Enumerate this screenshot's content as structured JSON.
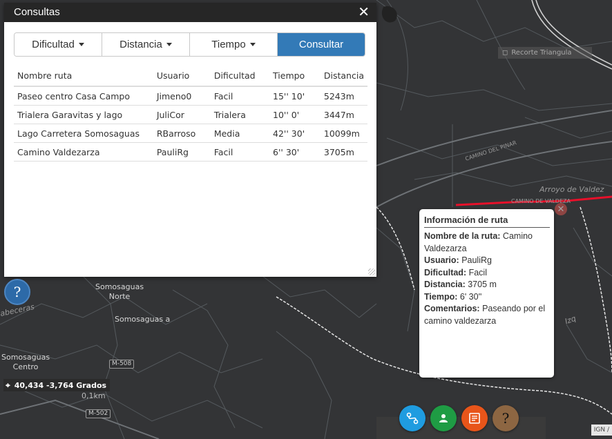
{
  "dialog": {
    "title": "Consultas",
    "close_glyph": "✕",
    "filters": [
      "Dificultad",
      "Distancia",
      "Tiempo"
    ],
    "consult_label": "Consultar",
    "table": {
      "headers": [
        "Nombre ruta",
        "Usuario",
        "Dificultad",
        "Tiempo",
        "Distancia"
      ],
      "rows": [
        [
          "Paseo centro Casa Campo",
          "Jimeno0",
          "Facil",
          "15'' 10'",
          "5243m"
        ],
        [
          "Trialera Garavitas y lago",
          "JuliCor",
          "Trialera",
          "10'' 0'",
          "3447m"
        ],
        [
          "Lago Carretera Somosaguas",
          "RBarroso",
          "Media",
          "42'' 30'",
          "10099m"
        ],
        [
          "Camino Valdezarza",
          "PauliRg",
          "Facil",
          "6'' 30'",
          "3705m"
        ]
      ]
    }
  },
  "help_left_glyph": "?",
  "coords": {
    "text": "40,434 -3,764 Grados",
    "icon": "crosshair-icon"
  },
  "map_labels": {
    "somosaguas_norte_1": "Somosaguas",
    "somosaguas_norte_2": "Norte",
    "somosaguas_a": "Somosaguas a",
    "somosaguas_centro_1": "Somosaguas",
    "somosaguas_centro_2": "Centro",
    "abecera": "abeceras",
    "arroyo": "Arroyo de Valdez",
    "camino_pinar": "CAMINO DEL PINAR",
    "camino_valdez": "CAMINO DE VALDEZA",
    "m508": "M-508",
    "m502": "M-502",
    "km": "0,1km",
    "izq": "Izq"
  },
  "map_search_placeholder": "Recorte Triangula",
  "info_popup": {
    "title": "Información de ruta",
    "name_label": "Nombre de la ruta:",
    "name_value": "Camino Valdezarza",
    "user_label": "Usuario:",
    "user_value": "PauliRg",
    "difficulty_label": "Dificultad:",
    "difficulty_value": "Facil",
    "distance_label": "Distancia:",
    "distance_value": "3705 m",
    "time_label": "Tiempo:",
    "time_value": "6' 30''",
    "comments_label": "Comentarios:",
    "comments_value": "Paseando por el camino valdezarza"
  },
  "remove_marker_glyph": "✕",
  "toolbar": {
    "route_icon": "route-icon",
    "user_icon": "user-icon",
    "list_icon": "list-icon",
    "help_glyph": "?"
  },
  "attribution": "IGN /",
  "colors": {
    "header_bg": "#262626",
    "consult_btn": "#337ab7",
    "route_line": "#e8102a",
    "map_bg": "#333436"
  }
}
